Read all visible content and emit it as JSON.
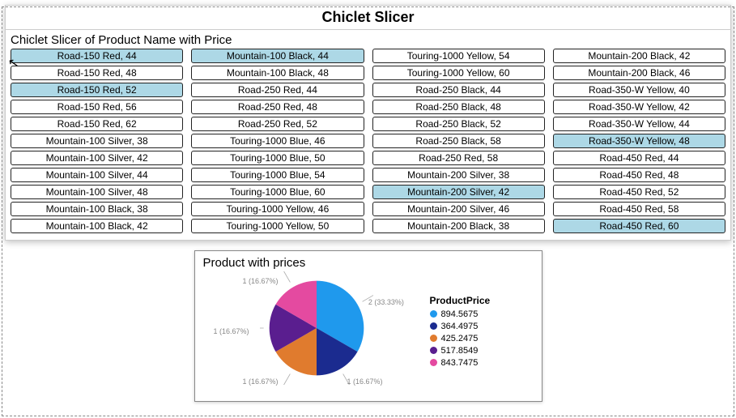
{
  "header": {
    "title": "Chiclet Slicer"
  },
  "slicer": {
    "heading": "Chiclet Slicer of Product Name with Price",
    "items": [
      {
        "label": "Road-150 Red, 44",
        "selected": true
      },
      {
        "label": "Road-150 Red, 48",
        "selected": false
      },
      {
        "label": "Road-150 Red, 52",
        "selected": true
      },
      {
        "label": "Road-150 Red, 56",
        "selected": false
      },
      {
        "label": "Road-150 Red, 62",
        "selected": false
      },
      {
        "label": "Mountain-100 Silver, 38",
        "selected": false
      },
      {
        "label": "Mountain-100 Silver, 42",
        "selected": false
      },
      {
        "label": "Mountain-100 Silver, 44",
        "selected": false
      },
      {
        "label": "Mountain-100 Silver, 48",
        "selected": false
      },
      {
        "label": "Mountain-100 Black, 38",
        "selected": false
      },
      {
        "label": "Mountain-100 Black, 42",
        "selected": false
      },
      {
        "label": "Mountain-100 Black, 44",
        "selected": true
      },
      {
        "label": "Mountain-100 Black, 48",
        "selected": false
      },
      {
        "label": "Road-250 Red, 44",
        "selected": false
      },
      {
        "label": "Road-250 Red, 48",
        "selected": false
      },
      {
        "label": "Road-250 Red, 52",
        "selected": false
      },
      {
        "label": "Touring-1000 Blue, 46",
        "selected": false
      },
      {
        "label": "Touring-1000 Blue, 50",
        "selected": false
      },
      {
        "label": "Touring-1000 Blue, 54",
        "selected": false
      },
      {
        "label": "Touring-1000 Blue, 60",
        "selected": false
      },
      {
        "label": "Touring-1000 Yellow, 46",
        "selected": false
      },
      {
        "label": "Touring-1000 Yellow, 50",
        "selected": false
      },
      {
        "label": "Touring-1000 Yellow, 54",
        "selected": false
      },
      {
        "label": "Touring-1000 Yellow, 60",
        "selected": false
      },
      {
        "label": "Road-250 Black, 44",
        "selected": false
      },
      {
        "label": "Road-250 Black, 48",
        "selected": false
      },
      {
        "label": "Road-250 Black, 52",
        "selected": false
      },
      {
        "label": "Road-250 Black, 58",
        "selected": false
      },
      {
        "label": "Road-250 Red, 58",
        "selected": false
      },
      {
        "label": "Mountain-200 Silver, 38",
        "selected": false
      },
      {
        "label": "Mountain-200 Silver, 42",
        "selected": true
      },
      {
        "label": "Mountain-200 Silver, 46",
        "selected": false
      },
      {
        "label": "Mountain-200 Black, 38",
        "selected": false
      },
      {
        "label": "Mountain-200 Black, 42",
        "selected": false
      },
      {
        "label": "Mountain-200 Black, 46",
        "selected": false
      },
      {
        "label": "Road-350-W Yellow, 40",
        "selected": false
      },
      {
        "label": "Road-350-W Yellow, 42",
        "selected": false
      },
      {
        "label": "Road-350-W Yellow, 44",
        "selected": false
      },
      {
        "label": "Road-350-W Yellow, 48",
        "selected": true
      },
      {
        "label": "Road-450 Red, 44",
        "selected": false
      },
      {
        "label": "Road-450 Red, 48",
        "selected": false
      },
      {
        "label": "Road-450 Red, 52",
        "selected": false
      },
      {
        "label": "Road-450 Red, 58",
        "selected": false
      },
      {
        "label": "Road-450 Red, 60",
        "selected": true
      }
    ]
  },
  "chart": {
    "title": "Product with prices",
    "legend_title": "ProductPrice",
    "legend": [
      {
        "label": "894.5675",
        "color": "#1f99ed"
      },
      {
        "label": "364.4975",
        "color": "#1b2b8f"
      },
      {
        "label": "425.2475",
        "color": "#e07b2e"
      },
      {
        "label": "517.8549",
        "color": "#5a1e8f"
      },
      {
        "label": "843.7475",
        "color": "#e44aa0"
      }
    ]
  },
  "chart_data": {
    "type": "pie",
    "title": "Product with prices",
    "series_name": "ProductPrice",
    "slices": [
      {
        "category": "894.5675",
        "count": 2,
        "pct": 33.33,
        "color": "#1f99ed"
      },
      {
        "category": "364.4975",
        "count": 1,
        "pct": 16.67,
        "color": "#1b2b8f"
      },
      {
        "category": "425.2475",
        "count": 1,
        "pct": 16.67,
        "color": "#e07b2e"
      },
      {
        "category": "517.8549",
        "count": 1,
        "pct": 16.67,
        "color": "#5a1e8f"
      },
      {
        "category": "843.7475",
        "count": 1,
        "pct": 16.67,
        "color": "#e44aa0"
      }
    ]
  }
}
